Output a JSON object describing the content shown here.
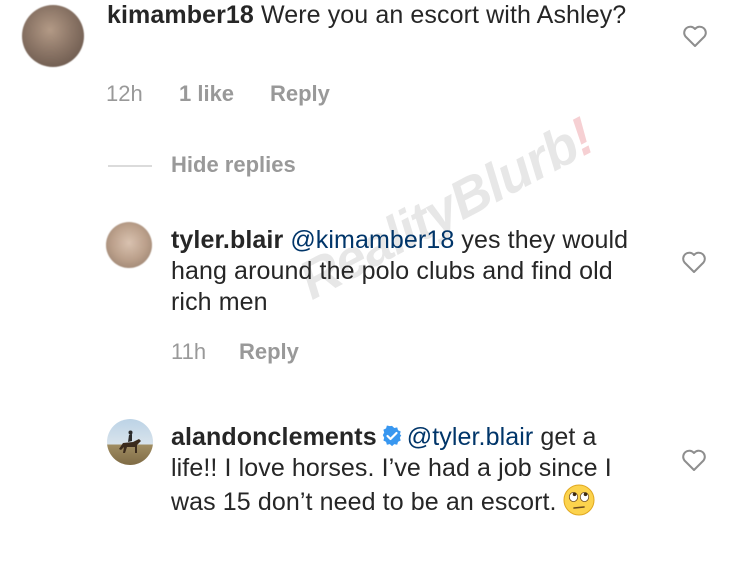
{
  "comments": [
    {
      "username": "kimamber18",
      "text": "Were you an escort with Ashley?",
      "time": "12h",
      "likes": "1 like",
      "reply": "Reply"
    },
    {
      "username": "tyler.blair",
      "mention": "@kimamber18",
      "text": "yes they would hang around the polo clubs and find old rich men",
      "time": "11h",
      "reply": "Reply"
    },
    {
      "username": "alandonclements",
      "verified": true,
      "mention": "@tyler.blair",
      "text": "get a life!! I love horses. I’ve had a job since I was 15 don’t need to be an escort.",
      "emoji": "face-with-rolling-eyes"
    }
  ],
  "hide_replies": "Hide replies",
  "watermark": {
    "main": "RealityBlurb",
    "bang": "!"
  },
  "colors": {
    "username": "#262626",
    "mention": "#003569",
    "meta": "#999999",
    "verified": "#3897f0",
    "divider": "#dbdbdb"
  }
}
